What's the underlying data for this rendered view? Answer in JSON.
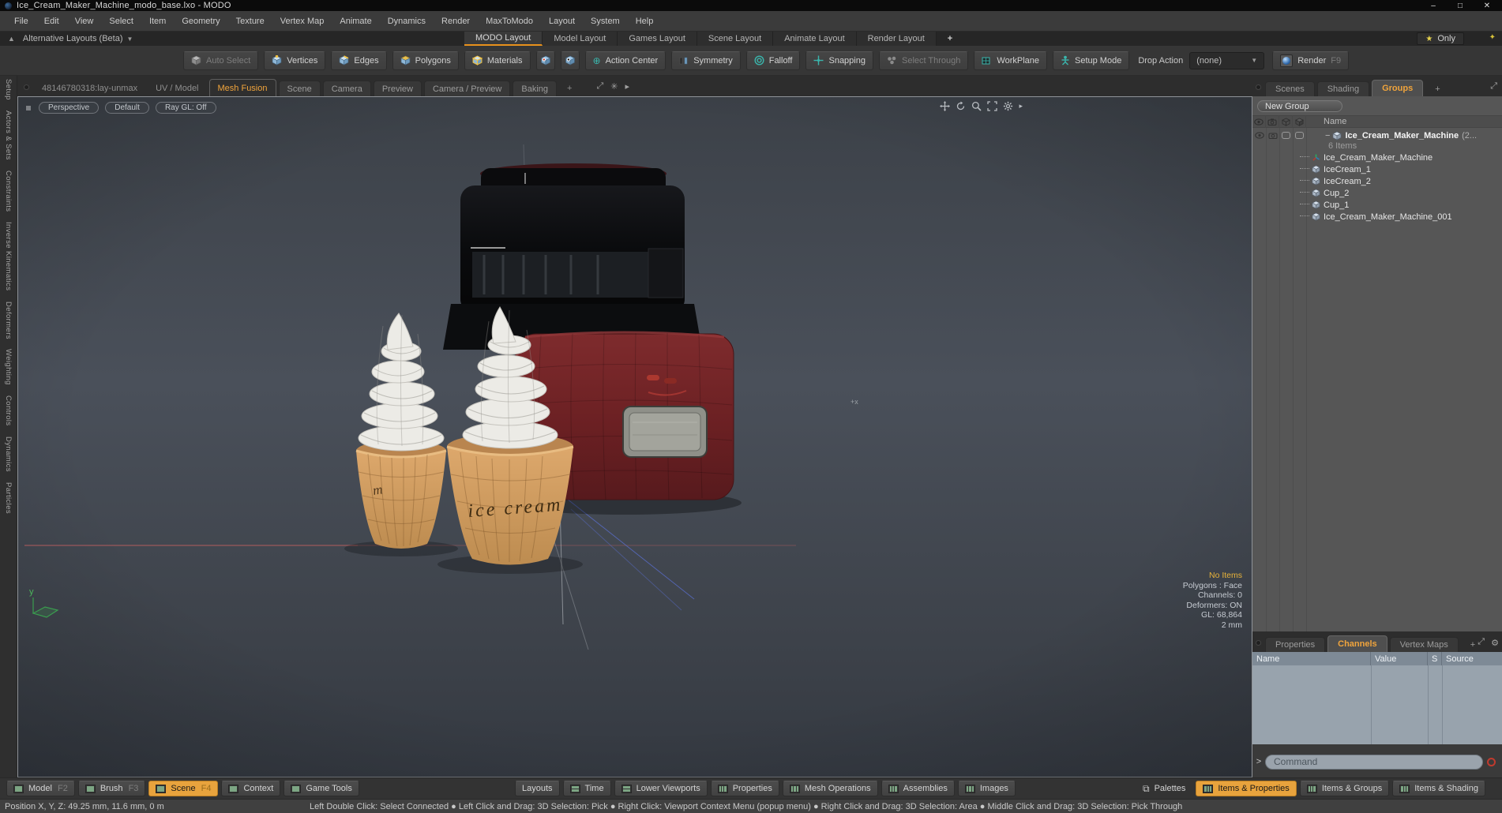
{
  "window": {
    "title": "Ice_Cream_Maker_Machine_modo_base.lxo - MODO"
  },
  "menu": {
    "items": [
      "File",
      "Edit",
      "View",
      "Select",
      "Item",
      "Geometry",
      "Texture",
      "Vertex Map",
      "Animate",
      "Dynamics",
      "Render",
      "MaxToModo",
      "Layout",
      "System",
      "Help"
    ]
  },
  "layout_bar": {
    "alt_layouts_label": "Alternative Layouts (Beta)",
    "tabs": [
      {
        "label": "MODO Layout"
      },
      {
        "label": "Model Layout"
      },
      {
        "label": "Games Layout"
      },
      {
        "label": "Scene Layout"
      },
      {
        "label": "Animate Layout"
      },
      {
        "label": "Render Layout"
      },
      {
        "label": "+"
      }
    ],
    "only_label": "Only"
  },
  "toolbar": {
    "auto_select": "Auto Select",
    "vertices": "Vertices",
    "edges": "Edges",
    "polygons": "Polygons",
    "materials": "Materials",
    "action_center": "Action Center",
    "symmetry": "Symmetry",
    "falloff": "Falloff",
    "snapping": "Snapping",
    "select_through": "Select Through",
    "workplane": "WorkPlane",
    "setup_mode": "Setup Mode",
    "drop_action_label": "Drop Action",
    "drop_action_value": "(none)",
    "render_label": "Render",
    "render_shortcut": "F9"
  },
  "viewport_tabs": {
    "items": [
      {
        "label": "48146780318:lay-unmax"
      },
      {
        "label": "UV / Model"
      },
      {
        "label": "Mesh Fusion"
      },
      {
        "label": "Scene"
      },
      {
        "label": "Camera"
      },
      {
        "label": "Preview"
      },
      {
        "label": "Camera / Preview"
      },
      {
        "label": "Baking"
      },
      {
        "label": "+"
      }
    ]
  },
  "left_tabs": [
    "Setup",
    "Actors & Sets",
    "Constraints",
    "Inverse Kinematics",
    "Deformers",
    "Weighting",
    "Controls",
    "Dynamics",
    "Particles"
  ],
  "viewport": {
    "controls": [
      {
        "label": "Perspective"
      },
      {
        "label": "Default"
      },
      {
        "label": "Ray GL: Off"
      }
    ],
    "stats": [
      "No Items",
      "Polygons : Face",
      "Channels: 0",
      "Deformers: ON",
      "GL: 68,864",
      "2 mm"
    ],
    "axis_label": "y",
    "workplane_label": "+x",
    "cup_text": "ice cream",
    "cup_text_partial": "m"
  },
  "groups_panel": {
    "tabs": [
      {
        "label": "Scenes"
      },
      {
        "label": "Shading"
      },
      {
        "label": "Groups"
      },
      {
        "label": "+"
      }
    ],
    "new_group_label": "New Group",
    "name_header": "Name",
    "root": {
      "label": "Ice_Cream_Maker_Machine",
      "suffix": "(2...",
      "count": "6 Items"
    },
    "items": [
      {
        "label": "Ice_Cream_Maker_Machine",
        "icon": "locator-icon"
      },
      {
        "label": "IceCream_1",
        "icon": "mesh-icon"
      },
      {
        "label": "IceCream_2",
        "icon": "mesh-icon"
      },
      {
        "label": "Cup_2",
        "icon": "mesh-icon"
      },
      {
        "label": "Cup_1",
        "icon": "mesh-icon"
      },
      {
        "label": "Ice_Cream_Maker_Machine_001",
        "icon": "mesh-icon"
      }
    ]
  },
  "channels_panel": {
    "tabs": [
      {
        "label": "Properties"
      },
      {
        "label": "Channels"
      },
      {
        "label": "Vertex Maps"
      },
      {
        "label": "+"
      }
    ],
    "columns": [
      "Name",
      "Value",
      "S",
      "Source"
    ],
    "prompt": ">",
    "command_placeholder": "Command"
  },
  "bottom_bar": {
    "modes": [
      {
        "label": "Model",
        "key": "F2"
      },
      {
        "label": "Brush",
        "key": "F3"
      },
      {
        "label": "Scene",
        "key": "F4"
      },
      {
        "label": "Context",
        "key": ""
      },
      {
        "label": "Game Tools",
        "key": ""
      }
    ],
    "panels": [
      {
        "label": "Layouts"
      },
      {
        "label": "Time"
      },
      {
        "label": "Lower Viewports"
      },
      {
        "label": "Properties"
      },
      {
        "label": "Mesh Operations"
      },
      {
        "label": "Assemblies"
      },
      {
        "label": "Images"
      }
    ],
    "right": [
      {
        "label": "Palettes"
      },
      {
        "label": "Items & Properties"
      },
      {
        "label": "Items & Groups"
      },
      {
        "label": "Items & Shading"
      }
    ]
  },
  "status_bar": {
    "position": "Position X, Y, Z:   49.25 mm, 11.6 mm, 0 m",
    "hints": "Left Double Click: Select Connected  ●  Left Click and Drag: 3D Selection: Pick  ●  Right Click: Viewport Context Menu (popup menu)  ●  Right Click and Drag: 3D Selection: Area  ●  Middle Click and Drag: 3D Selection: Pick Through"
  },
  "colors": {
    "accent": "#f0a43c",
    "teal": "#3ab5ac",
    "machine_red": "#6d2124",
    "cup": "#d5a266",
    "star": "#e8d44d"
  }
}
